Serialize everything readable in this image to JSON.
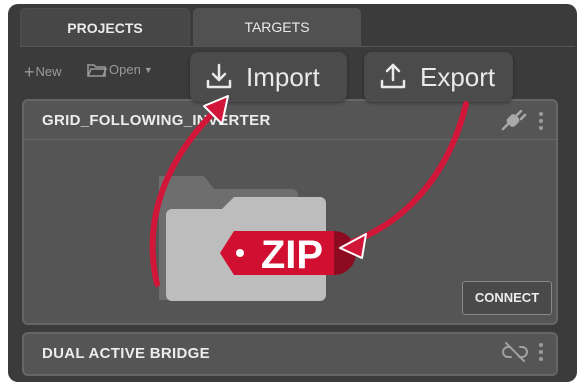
{
  "tabs": [
    {
      "label": "PROJECTS",
      "active": true
    },
    {
      "label": "TARGETS",
      "active": false
    }
  ],
  "toolbar": {
    "new_label": "New",
    "open_label": "Open"
  },
  "overlay": {
    "import_label": "Import",
    "export_label": "Export",
    "arrow_color": "#d2163a"
  },
  "projects": [
    {
      "name": "GRID_FOLLOWING_INVERTER",
      "status_icon": "plug-connected-icon",
      "button_label": "CONNECT",
      "expanded": true
    },
    {
      "name": "DUAL ACTIVE BRIDGE",
      "status_icon": "link-broken-icon",
      "expanded": false
    }
  ],
  "zip": {
    "label": "ZIP",
    "ribbon_color": "#c8102e"
  },
  "colors": {
    "panel_bg": "#3b3b3b",
    "card_bg": "#555555",
    "text": "#ececec"
  }
}
